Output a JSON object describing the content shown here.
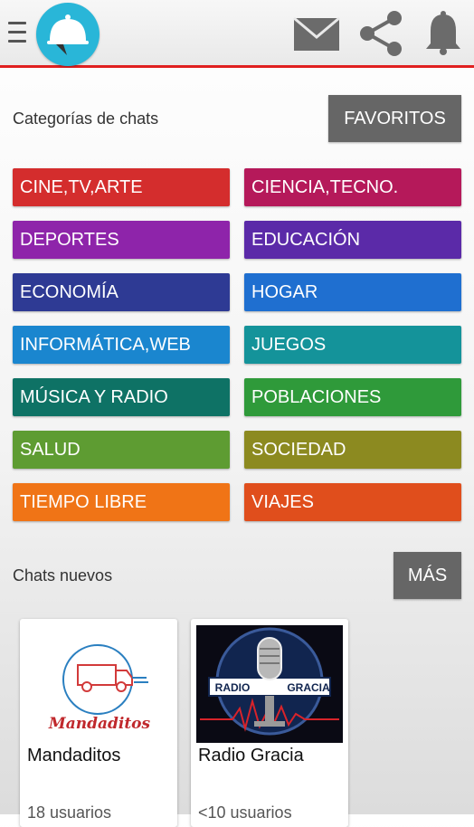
{
  "header": {
    "menu_icon": "menu-icon",
    "logo_icon": "cloche-logo",
    "actions": [
      "mail-icon",
      "share-icon",
      "bell-icon"
    ],
    "accent_color": "#e02020",
    "logo_color": "#29b6d8"
  },
  "categories": {
    "title": "Categorías de chats",
    "favorites_label": "FAVORITOS",
    "items": [
      {
        "label": "CINE,TV,ARTE",
        "color": "#d42d2d"
      },
      {
        "label": "CIENCIA,TECNO.",
        "color": "#b5195a"
      },
      {
        "label": "DEPORTES",
        "color": "#8e24aa"
      },
      {
        "label": "EDUCACIÓN",
        "color": "#5b2aa8"
      },
      {
        "label": "ECONOMÍA",
        "color": "#2e3a94"
      },
      {
        "label": "HOGAR",
        "color": "#1f6fd0"
      },
      {
        "label": "INFORMÁTICA,WEB",
        "color": "#1a86cf"
      },
      {
        "label": "JUEGOS",
        "color": "#14939a"
      },
      {
        "label": "MÚSICA Y RADIO",
        "color": "#0e7265"
      },
      {
        "label": "POBLACIONES",
        "color": "#2f9a3a"
      },
      {
        "label": "SALUD",
        "color": "#5e9c32"
      },
      {
        "label": "SOCIEDAD",
        "color": "#8c8a20"
      },
      {
        "label": "TIEMPO LIBRE",
        "color": "#f07416"
      },
      {
        "label": "VIAJES",
        "color": "#e04e1c"
      }
    ]
  },
  "new_chats": {
    "title": "Chats nuevos",
    "more_label": "MÁS",
    "cards": [
      {
        "title": "Mandaditos",
        "users": "18 usuarios",
        "logo_text": "Mandaditos"
      },
      {
        "title": "Radio Gracia",
        "users": "<10 usuarios",
        "badge_left": "RADIO",
        "badge_right": "GRACIA"
      }
    ]
  }
}
